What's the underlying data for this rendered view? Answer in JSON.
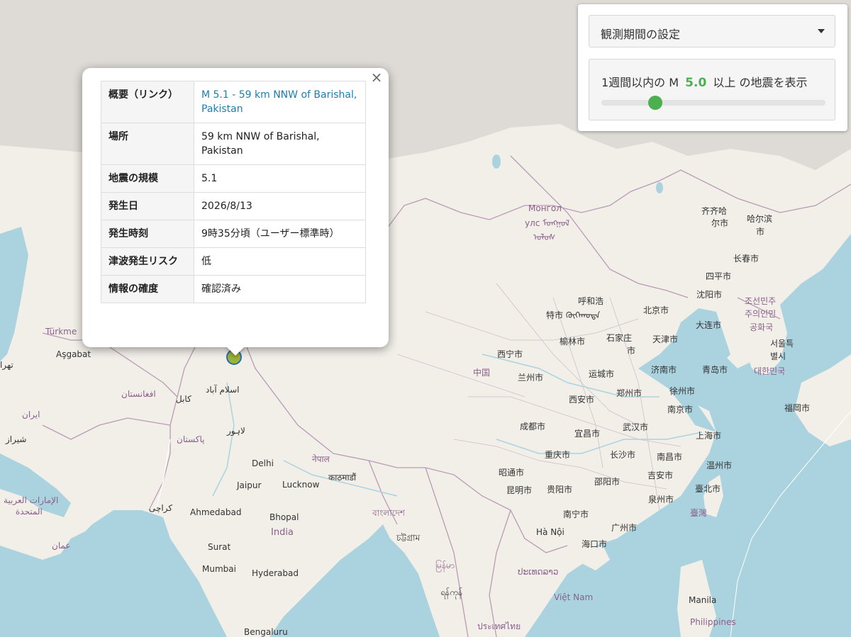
{
  "colors": {
    "water": "#aad3df",
    "land": "#f2efe9",
    "russia_land": "#dedbd6",
    "border": "#b89bb6",
    "accent_green": "#4caf50",
    "link": "#1a7fb0"
  },
  "popup": {
    "close_label": "×",
    "rows": [
      {
        "key": "概要（リンク）",
        "value": "M 5.1 - 59 km NNW of Barishal, Pakistan",
        "is_link": true
      },
      {
        "key": "場所",
        "value": "59 km NNW of Barishal, Pakistan"
      },
      {
        "key": "地震の規模",
        "value": "5.1"
      },
      {
        "key": "発生日",
        "value": "2026/8/13"
      },
      {
        "key": "発生時刻",
        "value": "9時35分頃（ユーザー標準時）"
      },
      {
        "key": "津波発生リスク",
        "value": "低"
      },
      {
        "key": "情報の確度",
        "value": "確認済み"
      }
    ]
  },
  "panel": {
    "period_label": "観測期間の設定",
    "mag_prefix": "1週間以内の M",
    "mag_value": "5.0",
    "mag_suffix": "以上 の地震を表示",
    "slider_fraction": 0.24
  },
  "map_labels": {
    "mongolia_1": "Монгол",
    "mongolia_2": "улс ᠮᠣᠩᠭᠣᠯ",
    "mongolia_3": "ᠤᠯᠤᠰ",
    "qiqihar": "齐齐哈",
    "qiqihar2": "尔市",
    "harbin": "哈尔滨",
    "harbin2": "市",
    "changchun": "长春市",
    "siping": "四平市",
    "shenyang": "沈阳市",
    "hohhot": "呼和浩",
    "special": "特市 ᠬᠥᠬᠡᠬᠣᠲᠠ",
    "beijing": "北京市",
    "dalian": "大连市",
    "nk1": "조선민주",
    "nk2": "주의인민",
    "nk3": "공화국",
    "seoul1": "서울특",
    "seoul2": "별시",
    "korea": "대한민국",
    "yulin": "榆林市",
    "shijiazhuang": "石家庄",
    "shijiazhuang2": "市",
    "tianjin": "天津市",
    "xining": "西宁市",
    "china": "中国",
    "lanzhou": "兰州市",
    "yuncheng": "运城市",
    "jinan": "济南市",
    "qingdao": "青岛市",
    "zhengzhou": "郑州市",
    "xuzhou": "徐州市",
    "xian": "西安市",
    "nanjing": "南京市",
    "fukuoka": "福岡市",
    "chengdu": "成都市",
    "yichang": "宜昌市",
    "wuhan": "武汉市",
    "shanghai": "上海市",
    "chongqing": "重庆市",
    "changsha": "长沙市",
    "nanchang": "南昌市",
    "wenzhou": "温州市",
    "zhaotong": "昭通市",
    "jian": "吉安市",
    "kunming": "昆明市",
    "guiyang": "贵阳市",
    "shaoyang": "邵阳市",
    "taipei": "臺北市",
    "quanzhou": "泉州市",
    "taiwan": "臺灣",
    "nanning": "南宁市",
    "guangzhou": "广州市",
    "hanoi": "Hà Nội",
    "haikou": "海口市",
    "vietnam": "Việt Nam",
    "manila": "Manila",
    "philippines": "Philippines",
    "thailand": "ประเทศไทย",
    "laos": "ປະເທດລາວ",
    "myanmar": "မြန်မာ",
    "myanmar2": "ရန်ကုန်",
    "chittagong": "চট্টগ্রাম",
    "bangladesh": "বাংলাদেশ",
    "kathmandu": "काठमाडौं",
    "nepal": "नेपाल",
    "lucknow": "Lucknow",
    "delhi": "Delhi",
    "jaipur": "Jaipur",
    "ahmedabad": "Ahmedabad",
    "bhopal": "Bhopal",
    "india": "India",
    "surat": "Surat",
    "mumbai": "Mumbai",
    "hyderabad": "Hyderabad",
    "bengaluru": "Bengaluru",
    "karachi": "کراچی",
    "lahore": "لاہور",
    "pakistan": "پاکستان",
    "islamabad": "اسلام آباد",
    "kabul": "کابل",
    "afghanistan": "افغانستان",
    "iran": "ایران",
    "shiraz": "شیراز",
    "uae1": "الإمارات العربية",
    "uae2": "المتحدة",
    "oman": "عمان",
    "turkmen": "Türkme",
    "ashgabat": "Aşgabat",
    "tehran": "تهرا"
  }
}
